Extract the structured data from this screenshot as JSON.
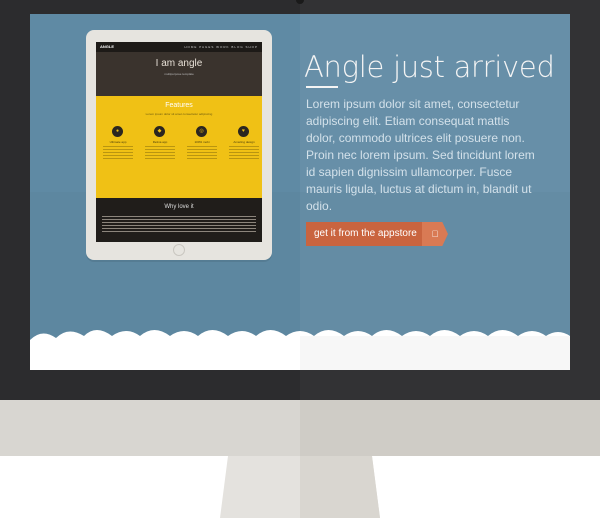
{
  "hero": {
    "title": "Angle just arrived",
    "body": "Lorem ipsum dolor sit amet, consectetur adipiscing elit. Etiam consequat mattis dolor, commodo ultrices elit posuere non. Proin nec lorem ipsum. Sed tincidunt lorem id sapien dignissim ullamcorper. Fusce mauris ligula, luctus at dictum in, blandit ut odio.",
    "cta_label": "get it from the appstore",
    "cta_icon": "apple-icon"
  },
  "tablet": {
    "logo": "ANGLE",
    "nav": "HOME  PAGES  WORK  BLOG  SHOP",
    "hero_title": "I am angle",
    "hero_sub": "multipurpose template",
    "features_title": "Features",
    "features_line": "Lorem ipsum dolor sit amet consectetur adipiscing",
    "feature_labels": [
      "Ultimate app",
      "Retina app",
      "100% mobi",
      "Amazing design"
    ],
    "why_title": "Why love it"
  },
  "colors": {
    "screen": "#5f8aa4",
    "bezel": "#2c2c2e",
    "accent": "#c9643f",
    "yellow": "#f0c115"
  }
}
